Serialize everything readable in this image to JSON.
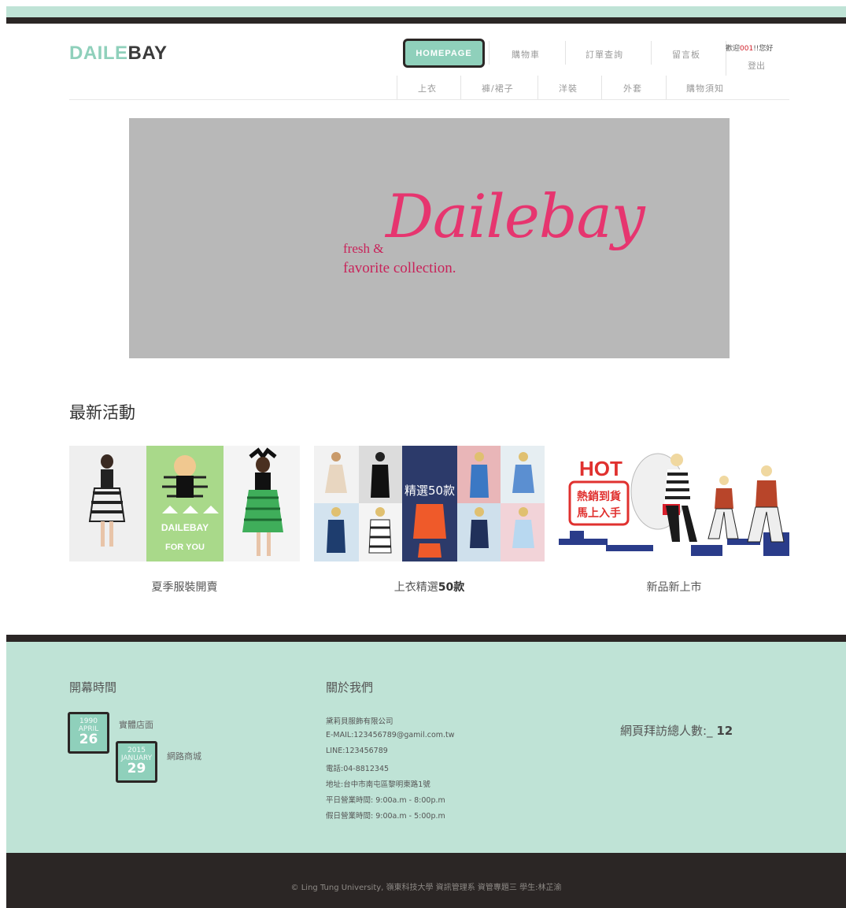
{
  "brand": {
    "logo_part1": "DAILE",
    "logo_part2": "BAY"
  },
  "nav": {
    "homepage": "HOMEPAGE",
    "top": [
      "購物車",
      "訂單查詢",
      "留言板"
    ],
    "sub": [
      "上衣",
      "褲/裙子",
      "洋裝",
      "外套",
      "購物須知"
    ]
  },
  "user": {
    "welcome_prefix": "歡迎",
    "user_id": "001",
    "welcome_suffix": "!!您好",
    "logout": "登出"
  },
  "banner": {
    "tagline_1": "fresh &",
    "tagline_2": "favorite collection.",
    "script_text": "Dailebay"
  },
  "events": {
    "title": "最新活動",
    "cards": [
      {
        "caption": "夏季服裝開賣",
        "art_text_1": "DAILEBAY",
        "art_text_2": "FOR YOU"
      },
      {
        "caption_prefix": "上衣精選",
        "caption_bold": "50款",
        "art_text_1": "精選50款"
      },
      {
        "caption": "新品新上市",
        "art_text_1": "HOT",
        "art_text_2": "熱銷到貨",
        "art_text_3": "馬上入手"
      }
    ]
  },
  "footer": {
    "opening_title": "開幕時間",
    "dates": [
      {
        "year": "1990",
        "month": "APRIL",
        "day": "26",
        "label": "實體店面"
      },
      {
        "year": "2015",
        "month": "JANUARY",
        "day": "29",
        "label": "網路商城"
      }
    ],
    "about_title": "關於我們",
    "about_lines": [
      "黛莉貝服飾有限公司",
      "E-MAIL:123456789@gamil.com.tw",
      "LINE:123456789",
      "電話:04-8812345",
      "地址:台中市南屯區黎明東路1號",
      "平日營業時間: 9:00a.m - 8:00p.m",
      "假日營業時間: 9:00a.m - 5:00p.m"
    ],
    "visits_label": "網頁拜訪總人數:_",
    "visits_count": "12",
    "copyright": "© Ling Tung University, 嶺東科技大學 資訊管理系 資管專題三 學生:林芷渝"
  },
  "colors": {
    "accent": "#8fd0bb",
    "dark": "#2b2625",
    "mint": "#bfe3d6",
    "banner_pink": "#e6356f"
  }
}
